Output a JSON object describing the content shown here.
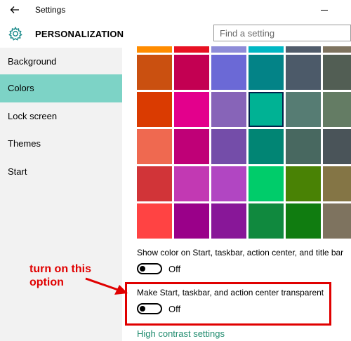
{
  "window": {
    "title": "Settings"
  },
  "header": {
    "title": "PERSONALIZATION",
    "search_placeholder": "Find a setting"
  },
  "sidebar": {
    "items": [
      {
        "label": "Background"
      },
      {
        "label": "Colors",
        "active": true
      },
      {
        "label": "Lock screen"
      },
      {
        "label": "Themes"
      },
      {
        "label": "Start"
      }
    ]
  },
  "colors": {
    "selected": "#00b294",
    "swatches": [
      "#ff8c00",
      "#e81123",
      "#8e8cd8",
      "#00b7c3",
      "#515c6b",
      "#7e735f",
      "#ca5010",
      "#c30052",
      "#6b69d6",
      "#038387",
      "#4c5a69",
      "#525e54",
      "#da3b01",
      "#e3008c",
      "#8764b8",
      "#00b294",
      "#567c73",
      "#647c64",
      "#ef6950",
      "#bf0077",
      "#744da9",
      "#018574",
      "#486860",
      "#4a5459",
      "#d13438",
      "#c239b3",
      "#b146c2",
      "#00cc6a",
      "#498205",
      "#847545",
      "#ff4343",
      "#9a0089",
      "#881798",
      "#10893e",
      "#107c10",
      "#7e735f"
    ]
  },
  "options": {
    "show_color": {
      "label": "Show color on Start, taskbar, action center, and title bar",
      "state": "Off"
    },
    "transparent": {
      "label": "Make Start, taskbar, and action center transparent",
      "state": "Off"
    }
  },
  "links": {
    "high_contrast": "High contrast settings"
  },
  "annotation": {
    "text_line1": "turn on this",
    "text_line2": "option",
    "color": "#e00000"
  },
  "theme": {
    "accent": "#7dd3c6",
    "link": "#1f8b6e"
  }
}
